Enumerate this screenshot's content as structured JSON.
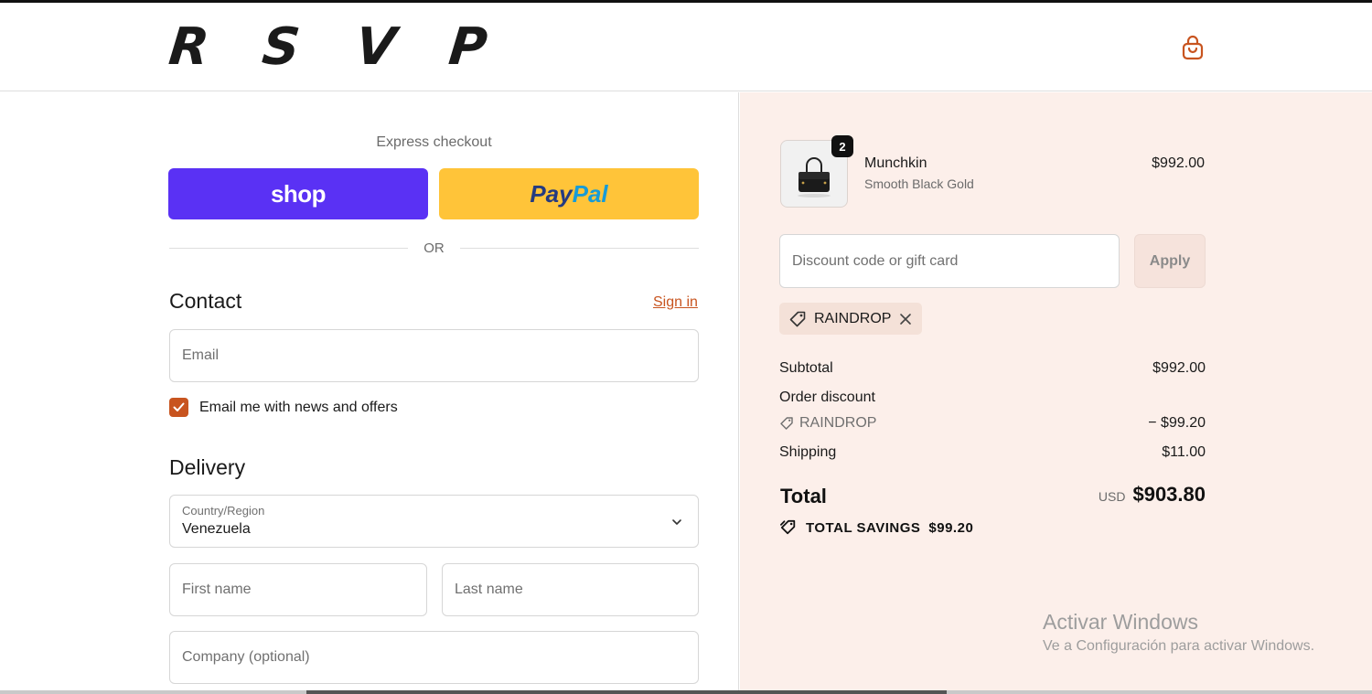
{
  "header": {
    "logo_letters": [
      "R",
      "S",
      "V",
      "P"
    ],
    "cart_icon": "shopping-bag-icon",
    "accent_color": "#c8541f"
  },
  "express": {
    "title": "Express checkout",
    "shop_label": "shop",
    "paypal_label_1": "Pay",
    "paypal_label_2": "Pal",
    "or_label": "OR"
  },
  "contact": {
    "title": "Contact",
    "sign_in": "Sign in",
    "email_placeholder": "Email",
    "newsletter_label": "Email me with news and offers",
    "newsletter_checked": true
  },
  "delivery": {
    "title": "Delivery",
    "country_label": "Country/Region",
    "country_value": "Venezuela",
    "first_name_placeholder": "First name",
    "last_name_placeholder": "Last name",
    "company_placeholder": "Company (optional)"
  },
  "order": {
    "product": {
      "quantity": "2",
      "name": "Munchkin",
      "variant": "Smooth Black Gold",
      "price": "$992.00"
    },
    "discount_placeholder": "Discount code or gift card",
    "apply_label": "Apply",
    "applied_code": "RAINDROP",
    "subtotal_label": "Subtotal",
    "subtotal_value": "$992.00",
    "order_discount_label": "Order discount",
    "discount_code_label": "RAINDROP",
    "discount_value": "− $99.20",
    "shipping_label": "Shipping",
    "shipping_value": "$11.00",
    "total_label": "Total",
    "currency": "USD",
    "total_value": "$903.80",
    "savings_label": "TOTAL SAVINGS",
    "savings_value": "$99.20"
  },
  "watermark": {
    "line1": "Activar Windows",
    "line2": "Ve a Configuración para activar Windows."
  }
}
